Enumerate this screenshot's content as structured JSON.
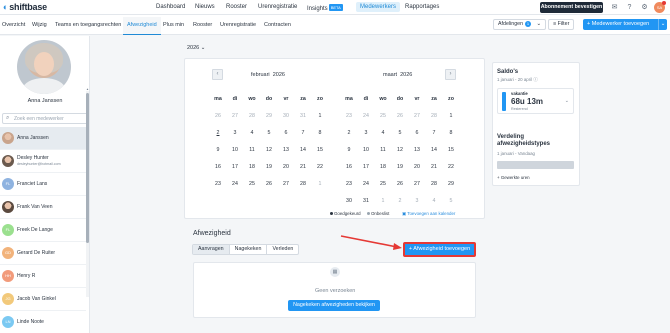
{
  "app": {
    "logo_text": "shiftbase",
    "brand_color": "#2196f3"
  },
  "topnav": {
    "items": [
      {
        "label": "Dashboard",
        "active": false
      },
      {
        "label": "Nieuws",
        "active": false
      },
      {
        "label": "Rooster",
        "active": false
      },
      {
        "label": "Urenregistratie",
        "active": false
      },
      {
        "label": "Insights",
        "badge": "BETA",
        "active": false
      },
      {
        "label": "Medewerkers",
        "active": true
      },
      {
        "label": "Rapportages",
        "active": false
      }
    ],
    "subscribe_label": "Abonnement bevestigen",
    "icons": [
      "megaphone-icon",
      "help-icon",
      "settings-icon"
    ],
    "avatar_initials": "SA"
  },
  "subnav": {
    "tabs": [
      "Overzicht",
      "Wijzig",
      "Teams en toegangsrechten",
      "Afwezigheid",
      "Plus min",
      "Rooster",
      "Urenregistratie",
      "Contracten"
    ],
    "active_tab": "Afwezigheid",
    "departments_label": "Afdelingen",
    "departments_count": "1",
    "filter_label": "Filter",
    "add_employee_label": "Medewerker toevoegen"
  },
  "profile": {
    "name": "Anna Janssen"
  },
  "search": {
    "placeholder": "Zoek een medewerker"
  },
  "employees": [
    {
      "initials": "AJ",
      "name": "Anna Janssen",
      "sub": "",
      "color": "#c9a48c",
      "photo": true,
      "active": true
    },
    {
      "initials": "DH",
      "name": "Desley Hunter",
      "sub": "desleyhunter@hotmail.com",
      "color": "#6b5a4e",
      "photo": true,
      "active": false
    },
    {
      "initials": "FL",
      "name": "Franciet Lans",
      "sub": "",
      "color": "#8fb3e0",
      "photo": false,
      "active": false
    },
    {
      "initials": "FV",
      "name": "Frank Van Veen",
      "sub": "",
      "color": "#5b4a3f",
      "photo": true,
      "active": false
    },
    {
      "initials": "FL",
      "name": "Freek De Lange",
      "sub": "",
      "color": "#9be08f",
      "photo": false,
      "active": false
    },
    {
      "initials": "GD",
      "name": "Gerard De Ruiter",
      "sub": "",
      "color": "#f2b37b",
      "photo": false,
      "active": false
    },
    {
      "initials": "HH",
      "name": "Henry R",
      "sub": "",
      "color": "#f29b7b",
      "photo": false,
      "active": false
    },
    {
      "initials": "JG",
      "name": "Jacob Van Ginkel",
      "sub": "",
      "color": "#f2c97b",
      "photo": false,
      "active": false
    },
    {
      "initials": "LN",
      "name": "Linde Noote",
      "sub": "",
      "color": "#7bc9f2",
      "photo": false,
      "active": false
    }
  ],
  "calendar": {
    "year": "2026",
    "weekdays": [
      "ma",
      "di",
      "wo",
      "do",
      "vr",
      "za",
      "zo"
    ],
    "months": [
      {
        "title": "februari",
        "year": "2026",
        "weeks": [
          [
            [
              "26",
              true
            ],
            [
              "27",
              true
            ],
            [
              "28",
              true
            ],
            [
              "29",
              true
            ],
            [
              "30",
              true
            ],
            [
              "31",
              true
            ],
            [
              "1",
              false
            ]
          ],
          [
            [
              "2",
              false,
              true
            ],
            [
              "3",
              false
            ],
            [
              "4",
              false
            ],
            [
              "5",
              false
            ],
            [
              "6",
              false
            ],
            [
              "7",
              false
            ],
            [
              "8",
              false
            ]
          ],
          [
            [
              "9",
              false
            ],
            [
              "10",
              false
            ],
            [
              "11",
              false
            ],
            [
              "12",
              false
            ],
            [
              "13",
              false
            ],
            [
              "14",
              false
            ],
            [
              "15",
              false
            ]
          ],
          [
            [
              "16",
              false
            ],
            [
              "17",
              false
            ],
            [
              "18",
              false
            ],
            [
              "19",
              false
            ],
            [
              "20",
              false
            ],
            [
              "21",
              false
            ],
            [
              "22",
              false
            ]
          ],
          [
            [
              "23",
              false
            ],
            [
              "24",
              false
            ],
            [
              "25",
              false
            ],
            [
              "26",
              false
            ],
            [
              "27",
              false
            ],
            [
              "28",
              false
            ],
            [
              "1",
              true
            ]
          ]
        ]
      },
      {
        "title": "maart",
        "year": "2026",
        "weeks": [
          [
            [
              "23",
              true
            ],
            [
              "24",
              true
            ],
            [
              "25",
              true
            ],
            [
              "26",
              true
            ],
            [
              "27",
              true
            ],
            [
              "28",
              true
            ],
            [
              "1",
              false
            ]
          ],
          [
            [
              "2",
              false
            ],
            [
              "3",
              false
            ],
            [
              "4",
              false
            ],
            [
              "5",
              false
            ],
            [
              "6",
              false
            ],
            [
              "7",
              false
            ],
            [
              "8",
              false
            ]
          ],
          [
            [
              "9",
              false
            ],
            [
              "10",
              false
            ],
            [
              "11",
              false
            ],
            [
              "12",
              false
            ],
            [
              "13",
              false
            ],
            [
              "14",
              false
            ],
            [
              "15",
              false
            ]
          ],
          [
            [
              "16",
              false
            ],
            [
              "17",
              false
            ],
            [
              "18",
              false
            ],
            [
              "19",
              false
            ],
            [
              "20",
              false
            ],
            [
              "21",
              false
            ],
            [
              "22",
              false
            ]
          ],
          [
            [
              "23",
              false
            ],
            [
              "24",
              false
            ],
            [
              "25",
              false
            ],
            [
              "26",
              false
            ],
            [
              "27",
              false
            ],
            [
              "28",
              false
            ],
            [
              "29",
              false
            ]
          ],
          [
            [
              "30",
              false
            ],
            [
              "31",
              false
            ],
            [
              "1",
              true
            ],
            [
              "2",
              true
            ],
            [
              "3",
              true
            ],
            [
              "4",
              true
            ],
            [
              "5",
              true
            ]
          ]
        ]
      }
    ],
    "legend": {
      "approved": "Goedgekeurd",
      "approved_color": "#2b3440",
      "pending": "Onbeslist",
      "pending_color": "#9aa5b1",
      "show_link": "Toevoegen aan kalender"
    }
  },
  "absence": {
    "title": "Afwezigheid",
    "tabs": [
      "Aanvragen",
      "Nagekeken",
      "Verleden"
    ],
    "active_tab": "Aanvragen",
    "add_label": "Afwezigheid toevoegen",
    "empty_text": "Geen verzoeken",
    "reviewed_button": "Nagekeken afwezigheden bekijken",
    "highlight_color": "#e53935"
  },
  "balances": {
    "title": "Saldo's",
    "period": "1 januari - 20 april",
    "vacation_label": "vakantie",
    "vacation_value": "68u 13m",
    "vacation_status": "Resterend",
    "dist_title": "Verdeling afwezigheidstypes",
    "dist_period": "1 januari - Vandaag",
    "worked_hours_link": "Gewerkte uren"
  }
}
